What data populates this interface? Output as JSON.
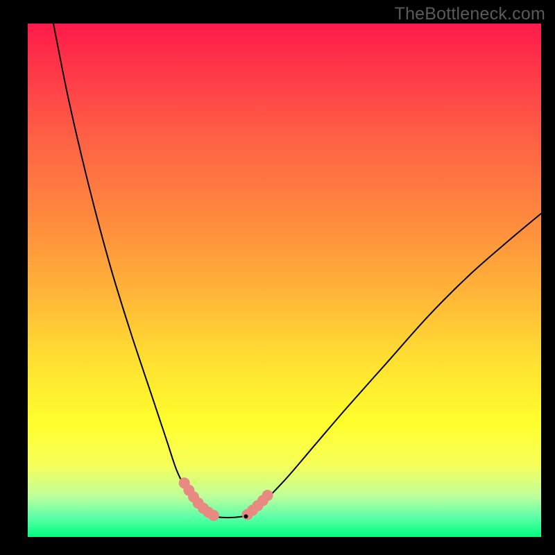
{
  "watermark": "TheBottleneck.com",
  "chart_data": {
    "type": "line",
    "title": "",
    "xlabel": "",
    "ylabel": "",
    "xlim": [
      0,
      100
    ],
    "ylim": [
      0,
      100
    ],
    "grid": false,
    "series": [
      {
        "name": "left-curve",
        "x": [
          5,
          8,
          12,
          16,
          20,
          24,
          27,
          29,
          31,
          33,
          34.5,
          36
        ],
        "y": [
          100,
          85,
          68,
          53,
          40,
          28,
          19,
          13,
          9,
          6,
          4.5,
          4
        ],
        "stroke": "#000000",
        "width": 2
      },
      {
        "name": "floor",
        "x": [
          36,
          38,
          40,
          42
        ],
        "y": [
          4,
          3.8,
          3.8,
          4
        ],
        "stroke": "#000000",
        "width": 2
      },
      {
        "name": "right-curve",
        "x": [
          42,
          45,
          50,
          56,
          62,
          70,
          78,
          86,
          94,
          100
        ],
        "y": [
          4,
          6,
          11,
          18,
          25,
          34,
          43,
          51,
          58,
          63
        ],
        "stroke": "#000000",
        "width": 2
      },
      {
        "name": "left-markers",
        "type": "scatter",
        "x": [
          30.5,
          31.4,
          32.3,
          33.2,
          34.2,
          35.2,
          36.2
        ],
        "y": [
          10.5,
          9.1,
          7.8,
          6.6,
          5.6,
          4.8,
          4.2
        ],
        "marker_color": "#e88a82",
        "marker_size": 16
      },
      {
        "name": "right-markers",
        "type": "scatter",
        "x": [
          42.8,
          43.8,
          44.8,
          45.8,
          46.7
        ],
        "y": [
          4.4,
          5.2,
          6.1,
          7.1,
          8.1
        ],
        "marker_color": "#e88a82",
        "marker_size": 16
      },
      {
        "name": "min-marker",
        "type": "scatter",
        "x": [
          42.5
        ],
        "y": [
          4.0
        ],
        "marker_color": "#000000",
        "marker_size": 6
      }
    ]
  }
}
